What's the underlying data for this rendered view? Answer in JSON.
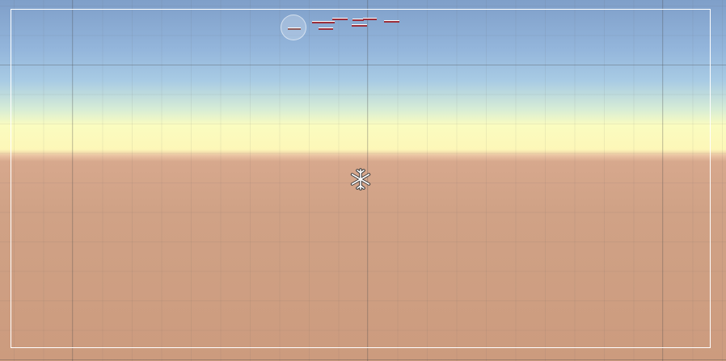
{
  "view": {
    "type": "scene-view",
    "sky_colors": [
      "#7f9fc9",
      "#a8cbe4",
      "#fafcc0",
      "#d7a88d"
    ],
    "ground_color": "#cc9b7e",
    "frame_color": "#ffffff"
  },
  "icons": {
    "button": "circle-button-icon",
    "light": "directional-light-icon"
  },
  "ui_elements": {
    "bar_color": "#9b2e3a",
    "bar_count": 7
  }
}
